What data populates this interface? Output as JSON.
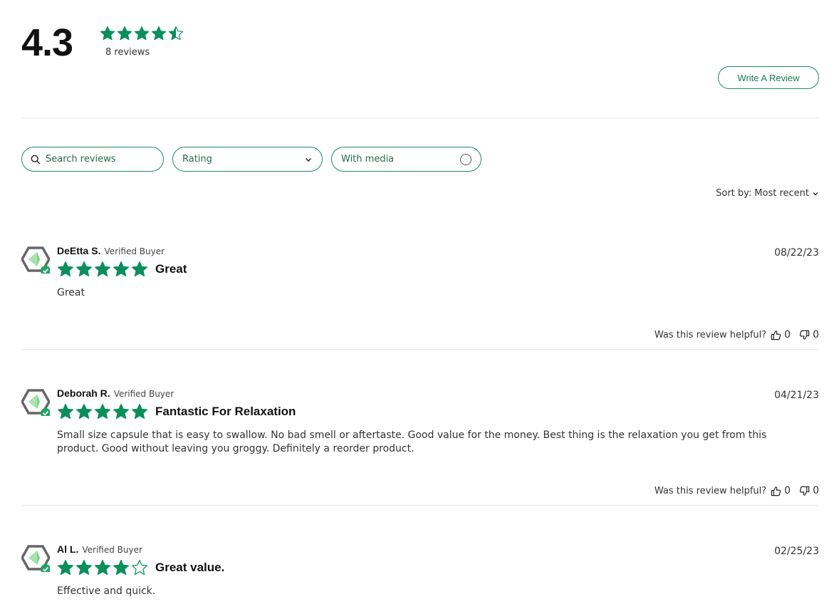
{
  "summary": {
    "average": "4.3",
    "rating_value": 4.3,
    "count_text": "8 reviews",
    "star_color": "#0a8f5b"
  },
  "actions": {
    "write_review": "Write A Review"
  },
  "filters": {
    "search_placeholder": "Search reviews",
    "rating_label": "Rating",
    "media_label": "With media"
  },
  "sort": {
    "label": "Sort by:",
    "value": "Most recent"
  },
  "helpful_prompt": "Was this review helpful?",
  "reviews": [
    {
      "author": "DeEtta S.",
      "badge": "Verified Buyer",
      "date": "08/22/23",
      "stars": 5,
      "title": "Great",
      "body": "Great",
      "up": "0",
      "down": "0"
    },
    {
      "author": "Deborah R.",
      "badge": "Verified Buyer",
      "date": "04/21/23",
      "stars": 5,
      "title": "Fantastic For Relaxation",
      "body": "Small size capsule that is easy to swallow. No bad smell or aftertaste. Good value for the money. Best thing is the relaxation you get from this product. Good without leaving you groggy. Definitely a reorder product.",
      "up": "0",
      "down": "0"
    },
    {
      "author": "Al L.",
      "badge": "Verified Buyer",
      "date": "02/25/23",
      "stars": 4,
      "title": "Great value.",
      "body": "Effective and quick."
    }
  ]
}
